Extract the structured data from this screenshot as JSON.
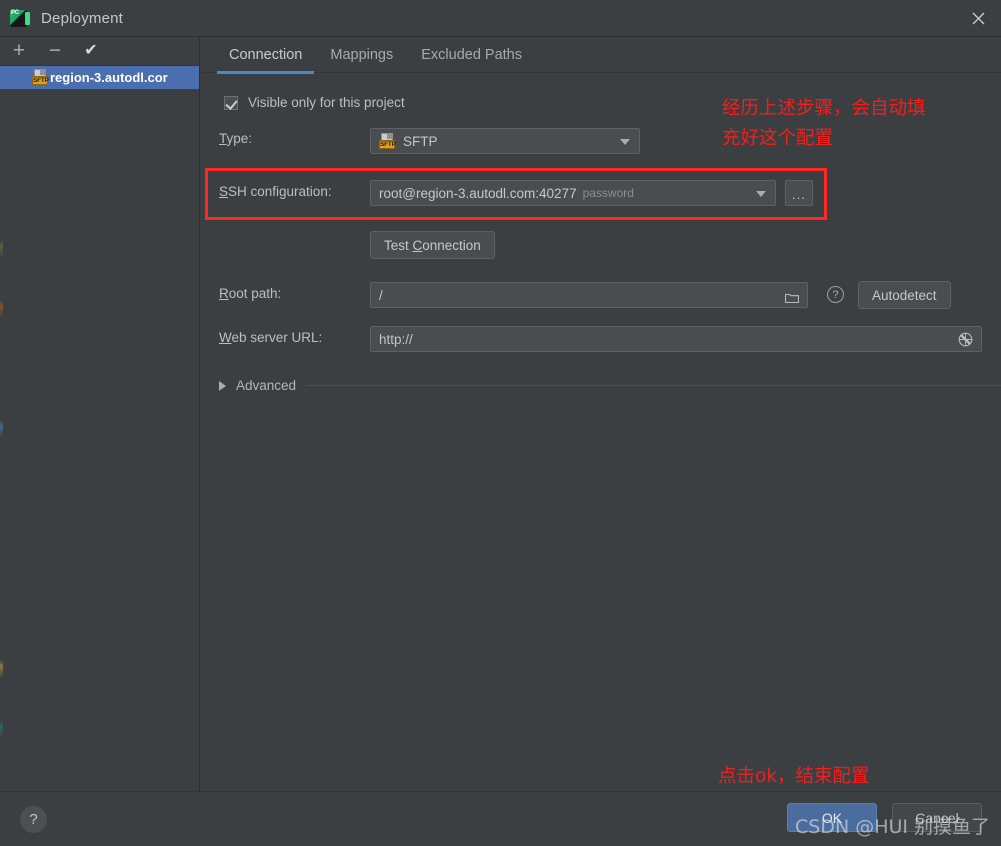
{
  "window": {
    "title": "Deployment",
    "app_icon": "pycharm-icon",
    "close_icon": "close-icon"
  },
  "left_panel": {
    "toolbar": [
      {
        "name": "add-server-button",
        "icon": "plus-icon",
        "label": "+"
      },
      {
        "name": "remove-server-button",
        "icon": "minus-icon",
        "label": "−"
      },
      {
        "name": "use-as-default-button",
        "icon": "check-icon",
        "label": "✔"
      }
    ],
    "items": [
      {
        "label": "region-3.autodl.cor",
        "icon": "sftp-file-icon",
        "badge": "SFTP",
        "selected": true
      }
    ],
    "scrollbar": "horizontal-scrollbar"
  },
  "tabs": [
    {
      "label": "Connection",
      "active": true
    },
    {
      "label": "Mappings",
      "active": false
    },
    {
      "label": "Excluded Paths",
      "active": false
    }
  ],
  "form": {
    "visible_only_checkbox": {
      "label": "Visible only for this project",
      "checked": true
    },
    "type": {
      "label": "Type:",
      "mnemonic": "T",
      "value": "SFTP",
      "icon": "sftp-file-icon",
      "badge": "SFTP"
    },
    "ssh_configuration": {
      "label": "SSH configuration:",
      "mnemonic": "S",
      "value": "root@region-3.autodl.com:40277",
      "suffix": "password",
      "browse_button": "..."
    },
    "test_connection_button": {
      "label": "Test Connection",
      "mnemonic": "C"
    },
    "root_path": {
      "label": "Root path:",
      "mnemonic": "R",
      "value": "/",
      "folder_icon": "folder-icon",
      "help_icon": "question-mark-icon",
      "autodetect_button": "Autodetect"
    },
    "web_server_url": {
      "label": "Web server URL:",
      "mnemonic": "W",
      "value": "http://",
      "globe_icon": "globe-icon"
    },
    "advanced": {
      "label": "Advanced",
      "expanded": false,
      "icon": "chevron-right-icon"
    }
  },
  "annotations": [
    {
      "name": "annotation-autofill",
      "text": "经历上述步骤，会自动填\n充好这个配置",
      "color": "#f31f1a"
    },
    {
      "name": "annotation-click-ok",
      "text": "点击ok，结束配置",
      "color": "#f31f1a"
    }
  ],
  "highlight_box": {
    "name": "ssh-configuration-highlight",
    "color": "#fc2a20"
  },
  "bottom": {
    "help_button": {
      "label": "?",
      "icon": "question-mark-icon"
    },
    "ok_button": {
      "label": "OK",
      "primary": true
    },
    "cancel_button": {
      "label": "Cancel",
      "primary": false
    }
  },
  "watermark": {
    "text": "CSDN @HUI 别摸鱼了"
  },
  "colors": {
    "window_bg": "#3c3f41",
    "field_bg": "#4a4d4f",
    "selection_blue": "#4b6eaf",
    "tab_underline": "#4a88c7",
    "annotation_red": "#f31f1a",
    "primary_button": "#4a6d9e"
  }
}
